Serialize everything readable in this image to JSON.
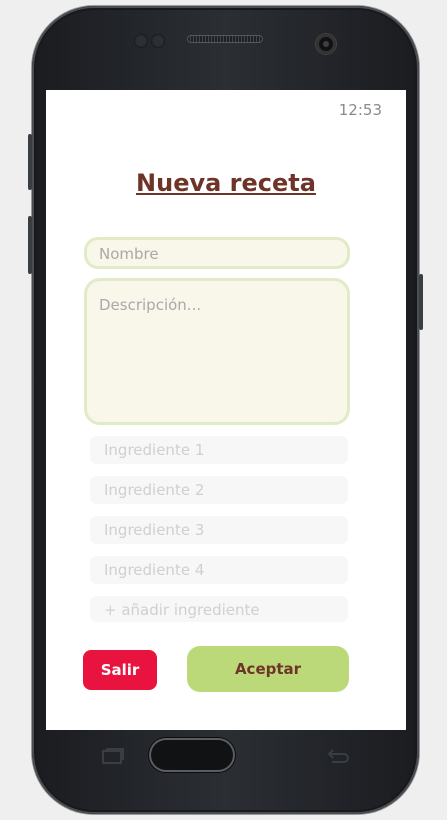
{
  "status_bar": {
    "time": "12:53"
  },
  "screen": {
    "title": "Nueva receta",
    "name_placeholder": "Nombre",
    "description_placeholder": "Descripción...",
    "ingredients": [
      "Ingrediente 1",
      "Ingrediente 2",
      "Ingrediente 3",
      "Ingrediente 4"
    ],
    "add_ingredient_label": "+ añadir ingrediente",
    "exit_label": "Salir",
    "accept_label": "Aceptar"
  },
  "colors": {
    "title": "#6e3428",
    "field_border": "#e1ebc8",
    "field_bg": "#f8f7ea",
    "exit_button": "#e8133f",
    "accept_button": "#bcd97a"
  },
  "icons": [
    "recent-apps-icon",
    "back-icon",
    "camera-icon",
    "speaker-grille",
    "home-button"
  ]
}
